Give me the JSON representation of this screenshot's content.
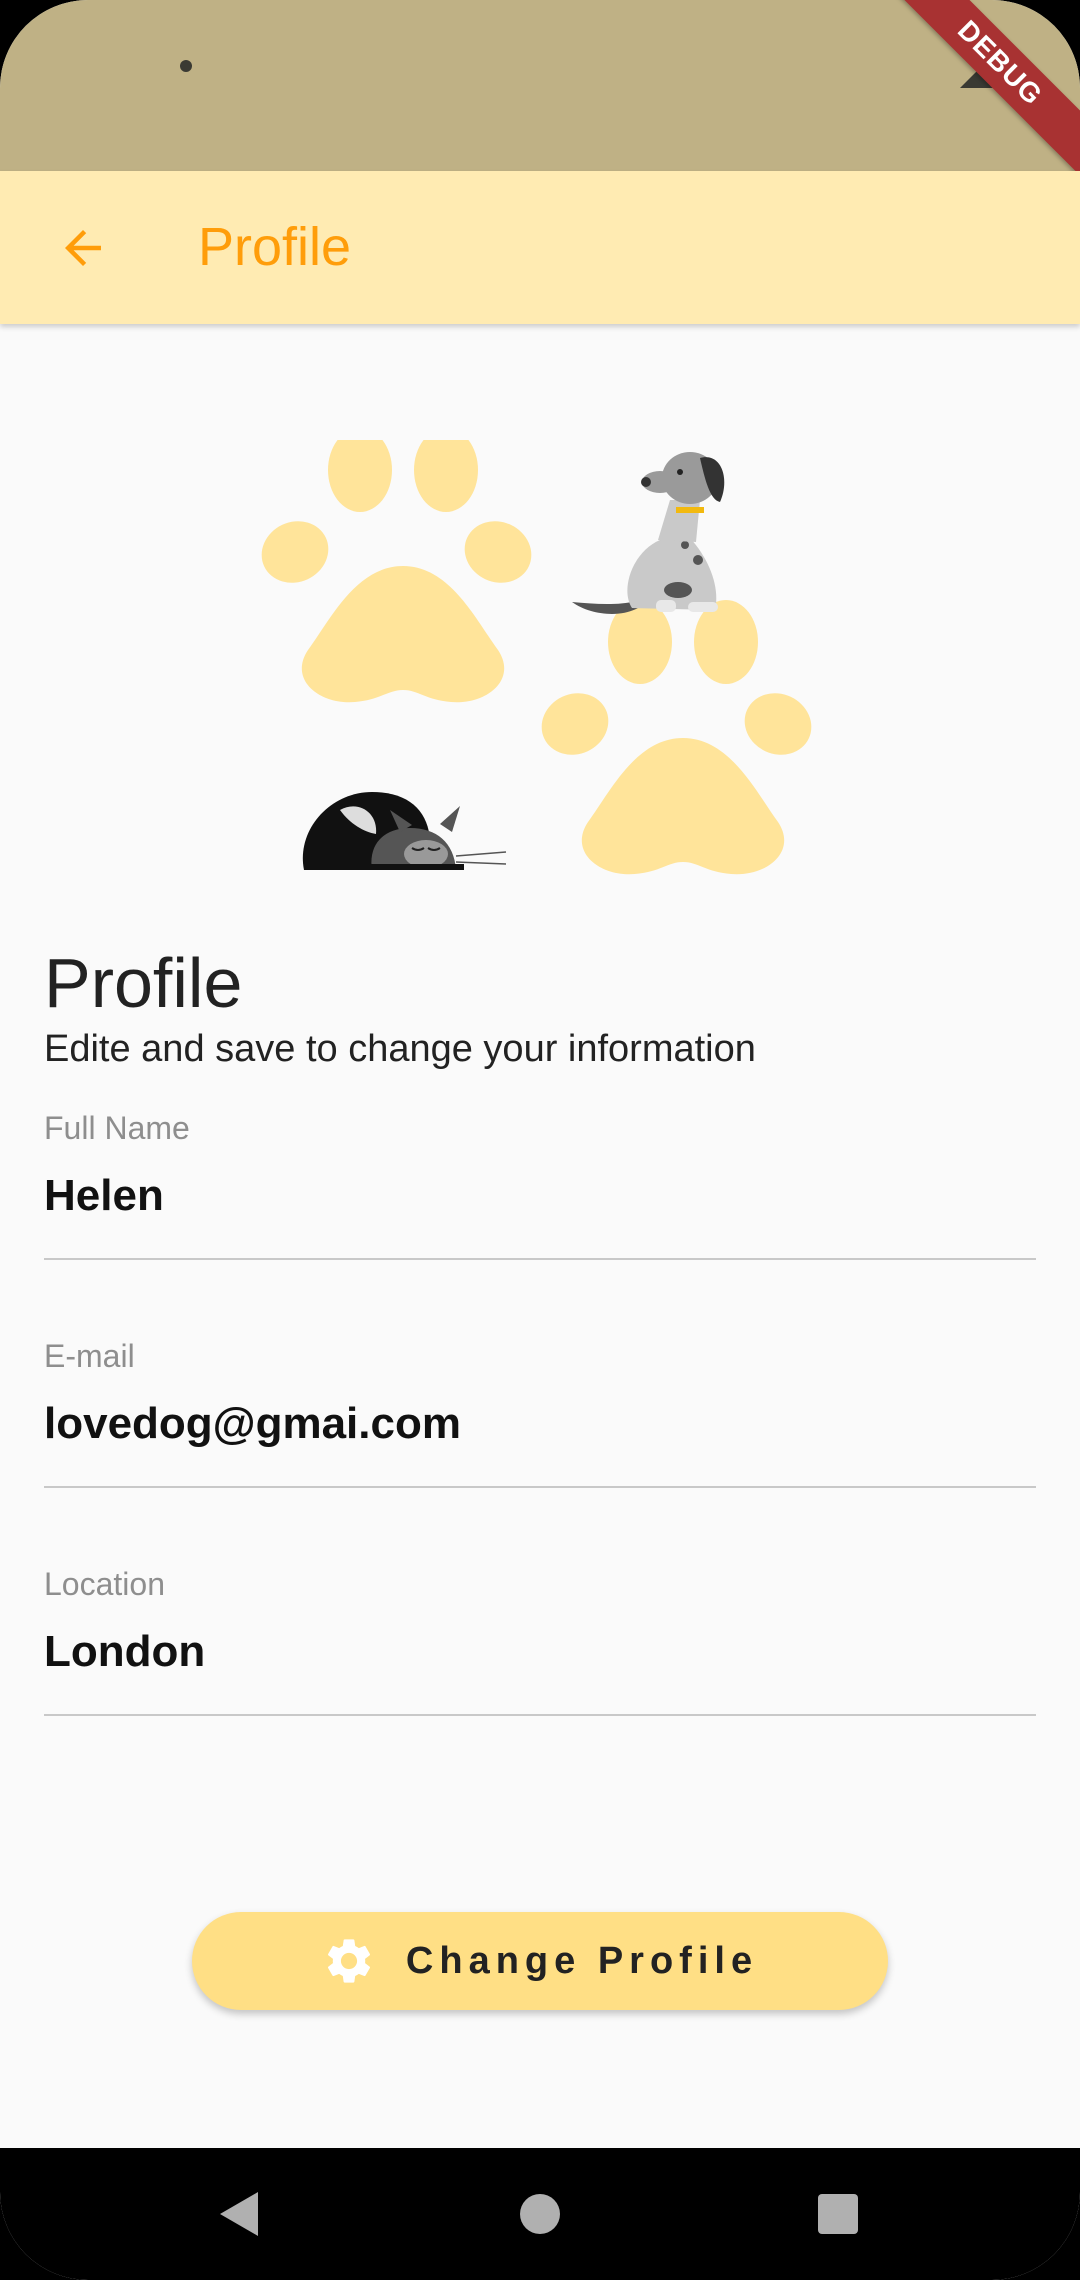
{
  "status_bar": {
    "debug_banner": "DEBUG"
  },
  "app_bar": {
    "title": "Profile",
    "back_icon": "arrow-back-icon"
  },
  "header": {
    "title": "Profile",
    "subtitle": "Edite and save to change your information"
  },
  "form": {
    "fields": [
      {
        "label": "Full Name",
        "value": "Helen"
      },
      {
        "label": "E-mail",
        "value": "lovedog@gmai.com"
      },
      {
        "label": "Location",
        "value": "London"
      }
    ]
  },
  "actions": {
    "change_profile_label": "Change Profile",
    "change_profile_icon": "gear-icon"
  },
  "colors": {
    "status_bar": "#bfb185",
    "app_bar": "#ffebb2",
    "accent": "#ff9d0a",
    "paw": "#ffe49a",
    "button": "#ffdf85"
  }
}
